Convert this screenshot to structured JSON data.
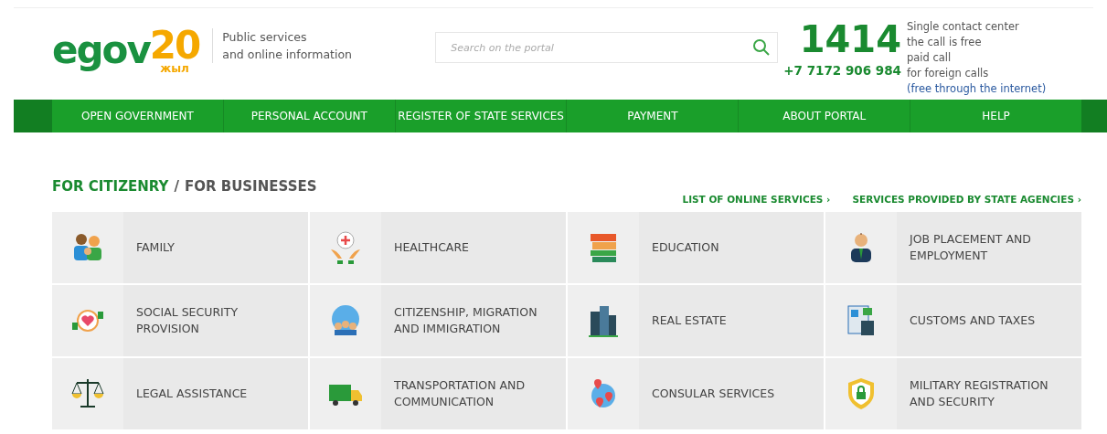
{
  "logo": {
    "main": "egov",
    "number": "20",
    "sub": "жыл"
  },
  "tagline": [
    "Public services",
    "and online information"
  ],
  "search": {
    "placeholder": "Search on the portal"
  },
  "contact": {
    "short_number": "1414",
    "phone": "+7 7172 906 984",
    "lines": [
      "Single contact center",
      "the call is free",
      "paid call",
      "for foreign calls"
    ],
    "link": "(free through the internet)"
  },
  "nav": [
    "OPEN GOVERNMENT",
    "PERSONAL ACCOUNT",
    "REGISTER OF STATE SERVICES",
    "PAYMENT",
    "ABOUT PORTAL",
    "HELP"
  ],
  "audience_tabs": [
    {
      "label": "FOR CITIZENRY",
      "selected": true
    },
    {
      "label": "FOR BUSINESSES",
      "selected": false
    }
  ],
  "separator": "/",
  "links": [
    "LIST OF ONLINE SERVICES ›",
    "SERVICES PROVIDED BY STATE AGENCIES ›"
  ],
  "categories": [
    {
      "label": "FAMILY"
    },
    {
      "label": "HEALTHCARE"
    },
    {
      "label": "EDUCATION"
    },
    {
      "label": "JOB PLACEMENT AND EMPLOYMENT"
    },
    {
      "label": "SOCIAL SECURITY PROVISION"
    },
    {
      "label": "CITIZENSHIP, MIGRATION AND IMMIGRATION"
    },
    {
      "label": "REAL ESTATE"
    },
    {
      "label": "CUSTOMS AND TAXES"
    },
    {
      "label": "LEGAL ASSISTANCE"
    },
    {
      "label": "TRANSPORTATION AND COMMUNICATION"
    },
    {
      "label": "CONSULAR SERVICES"
    },
    {
      "label": "MILITARY REGISTRATION AND SECURITY"
    }
  ]
}
